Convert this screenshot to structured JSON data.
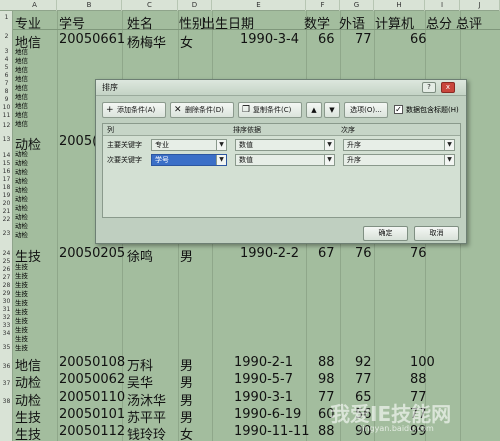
{
  "sheet": {
    "columns": [
      "A",
      "B",
      "C",
      "D",
      "E",
      "F",
      "G",
      "H",
      "I",
      "J"
    ],
    "headers": [
      "专业",
      "学号",
      "姓名",
      "性别",
      "出生日期",
      "数学",
      "外语",
      "计算机",
      "总分",
      "总评"
    ],
    "row2": [
      "地信",
      "20050661",
      "杨梅华",
      "女",
      "1990-3-4",
      "66",
      "77",
      "66"
    ],
    "row12": [
      "动检",
      "2005(",
      "",
      "",
      "",
      "",
      "",
      ""
    ],
    "row23": [
      "生技",
      "20050205",
      "徐鸣",
      "男",
      "1990-2-2",
      "67",
      "76",
      "76"
    ],
    "rows_bottom": [
      [
        "地信",
        "20050108",
        "万科",
        "男",
        "1990-2-1",
        "88",
        "92",
        "100"
      ],
      [
        "动检",
        "20050062",
        "吴华",
        "男",
        "1990-5-7",
        "98",
        "77",
        "88"
      ],
      [
        "动检",
        "20050110",
        "汤沐华",
        "男",
        "1990-3-1",
        "77",
        "65",
        "77"
      ],
      [
        "生技",
        "20050101",
        "苏平平",
        "男",
        "1990-6-19",
        "60",
        "56",
        "77"
      ],
      [
        "生技",
        "20050112",
        "钱玲玲",
        "女",
        "1990-11-11",
        "88",
        "90",
        "99"
      ]
    ],
    "small_group1": [
      "地信",
      "地信",
      "地信",
      "地信",
      "地信",
      "地信",
      "地信",
      "地信",
      "地信"
    ],
    "small_group2": [
      "动检",
      "动检",
      "动检",
      "动检",
      "动检",
      "动检",
      "动检",
      "动检",
      "动检",
      "动检"
    ],
    "small_group3": [
      "生技",
      "生技",
      "生技",
      "生技",
      "生技",
      "生技",
      "生技",
      "生技",
      "生技",
      "生技"
    ],
    "row_numbers": [
      "1",
      "2",
      "3",
      "4",
      "5",
      "6",
      "7",
      "8",
      "9",
      "10",
      "11",
      "12",
      "13",
      "14",
      "15",
      "16",
      "17",
      "18",
      "19",
      "20",
      "21",
      "22",
      "23",
      "24",
      "25",
      "26",
      "27",
      "28",
      "29",
      "30",
      "31",
      "32",
      "33",
      "34",
      "35",
      "36",
      "37",
      "38"
    ]
  },
  "dialog": {
    "title": "排序",
    "help": "?",
    "close": "x",
    "toolbar": {
      "add": "添加条件(A)",
      "delete": "删除条件(D)",
      "copy": "复制条件(C)",
      "up": "▲",
      "down": "▼",
      "options": "选项(O)...",
      "header_checkbox": "数据包含标题(H)"
    },
    "grid_headers": {
      "column": "列",
      "sort_on": "排序依据",
      "order": "次序"
    },
    "rows": [
      {
        "label": "主要关键字",
        "column": "专业",
        "sort_on": "数值",
        "order": "升序"
      },
      {
        "label": "次要关键字",
        "column": "学号",
        "sort_on": "数值",
        "order": "升序"
      }
    ],
    "ok": "确定",
    "cancel": "取消"
  },
  "watermark": {
    "main": "我爱IE技能网",
    "sub": "jingyan.baidu.com"
  }
}
